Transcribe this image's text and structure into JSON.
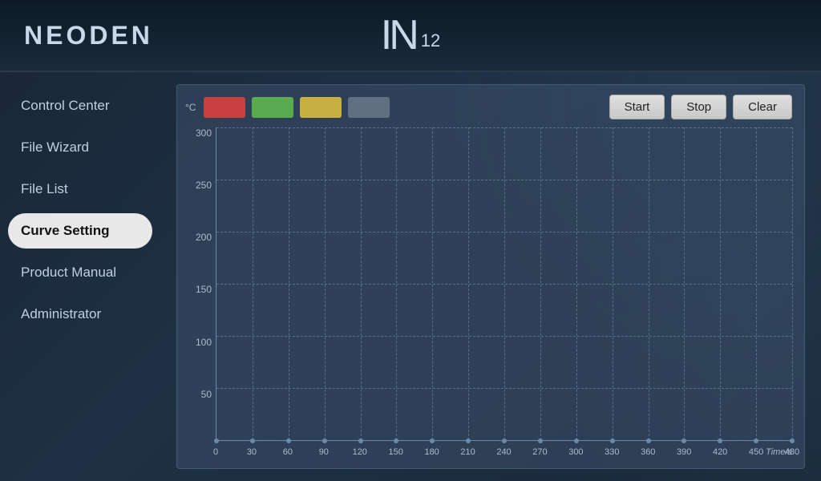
{
  "app": {
    "brand": "NEODEN",
    "logo_in": "IN",
    "logo_num": "12"
  },
  "sidebar": {
    "items": [
      {
        "id": "control-center",
        "label": "Control Center",
        "active": false
      },
      {
        "id": "file-wizard",
        "label": "File Wizard",
        "active": false
      },
      {
        "id": "file-list",
        "label": "File List",
        "active": false
      },
      {
        "id": "curve-setting",
        "label": "Curve Setting",
        "active": true
      },
      {
        "id": "product-manual",
        "label": "Product Manual",
        "active": false
      },
      {
        "id": "administrator",
        "label": "Administrator",
        "active": false
      }
    ]
  },
  "toolbar": {
    "unit": "°C",
    "legends": [
      {
        "id": "legend-red",
        "color": "#c84040"
      },
      {
        "id": "legend-green",
        "color": "#5aaa50"
      },
      {
        "id": "legend-yellow",
        "color": "#c8b040"
      },
      {
        "id": "legend-gray",
        "color": "#607080"
      }
    ],
    "start_label": "Start",
    "stop_label": "Stop",
    "clear_label": "Clear"
  },
  "chart": {
    "y_labels": [
      "300",
      "250",
      "200",
      "150",
      "100",
      "50"
    ],
    "x_labels": [
      "0",
      "30",
      "60",
      "90",
      "120",
      "150",
      "180",
      "210",
      "240",
      "270",
      "300",
      "330",
      "360",
      "390",
      "420",
      "450",
      "480"
    ],
    "x_unit": "Time/s"
  },
  "colors": {
    "accent": "#4a7a9b",
    "bg_dark": "#1a2535",
    "btn_bg": "#d0d0d0"
  }
}
